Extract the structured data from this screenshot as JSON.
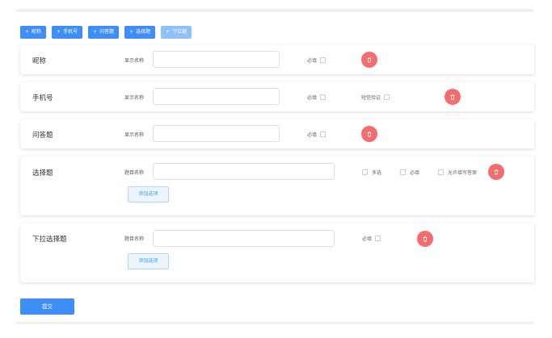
{
  "toolbar": {
    "buttons": [
      {
        "label": "昵称"
      },
      {
        "label": "手机号"
      },
      {
        "label": "问答题"
      },
      {
        "label": "选择题"
      },
      {
        "label": "下拉题"
      }
    ],
    "plus_glyph": "+"
  },
  "fields": {
    "nickname": {
      "title": "昵称",
      "name_label": "显示名称",
      "required_label": "必填"
    },
    "phone": {
      "title": "手机号",
      "name_label": "显示名称",
      "required_label": "必填",
      "sms_label": "短信验证"
    },
    "qa": {
      "title": "问答题",
      "name_label": "显示名称",
      "required_label": "必填"
    },
    "choice": {
      "title": "选择题",
      "name_label": "题目名称",
      "multi_label": "多选",
      "required_label": "必填",
      "allow_label": "允许填写答案",
      "add_option": "添加选项"
    },
    "dropdown": {
      "title": "下拉选择题",
      "name_label": "题目名称",
      "required_label": "必填",
      "add_option": "添加选项"
    }
  },
  "submit_label": "提交",
  "icons": {
    "delete": "trash-icon",
    "add": "plus-icon"
  },
  "colors": {
    "primary": "#3e8ef7",
    "primary_disabled": "#8ec0fa",
    "danger": "#f56c6c",
    "option_bg": "#ecf5ff",
    "option_text": "#409eff"
  }
}
